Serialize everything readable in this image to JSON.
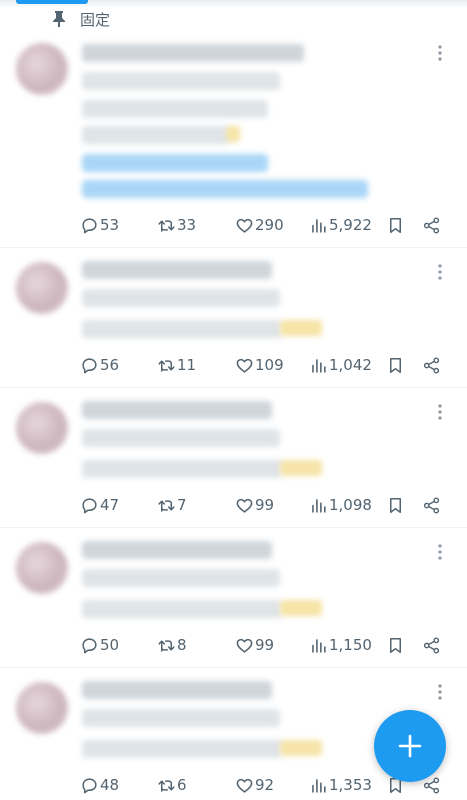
{
  "pinned_label": "固定",
  "colors": {
    "accent": "#1d9bf0",
    "icon_gray": "#536471"
  },
  "icons": {
    "reply": "speech-bubble-icon",
    "retweet": "retweet-arrows-icon",
    "like": "heart-icon",
    "views": "bar-chart-icon",
    "bookmark": "bookmark-icon",
    "share": "share-icon",
    "more": "vertical-dots-icon",
    "compose": "plus-icon"
  },
  "tweets": [
    {
      "replies": "53",
      "retweets": "33",
      "likes": "290",
      "views": "5,922"
    },
    {
      "replies": "56",
      "retweets": "11",
      "likes": "109",
      "views": "1,042"
    },
    {
      "replies": "47",
      "retweets": "7",
      "likes": "99",
      "views": "1,098"
    },
    {
      "replies": "50",
      "retweets": "8",
      "likes": "99",
      "views": "1,150"
    },
    {
      "replies": "48",
      "retweets": "6",
      "likes": "92",
      "views": "1,353"
    }
  ]
}
